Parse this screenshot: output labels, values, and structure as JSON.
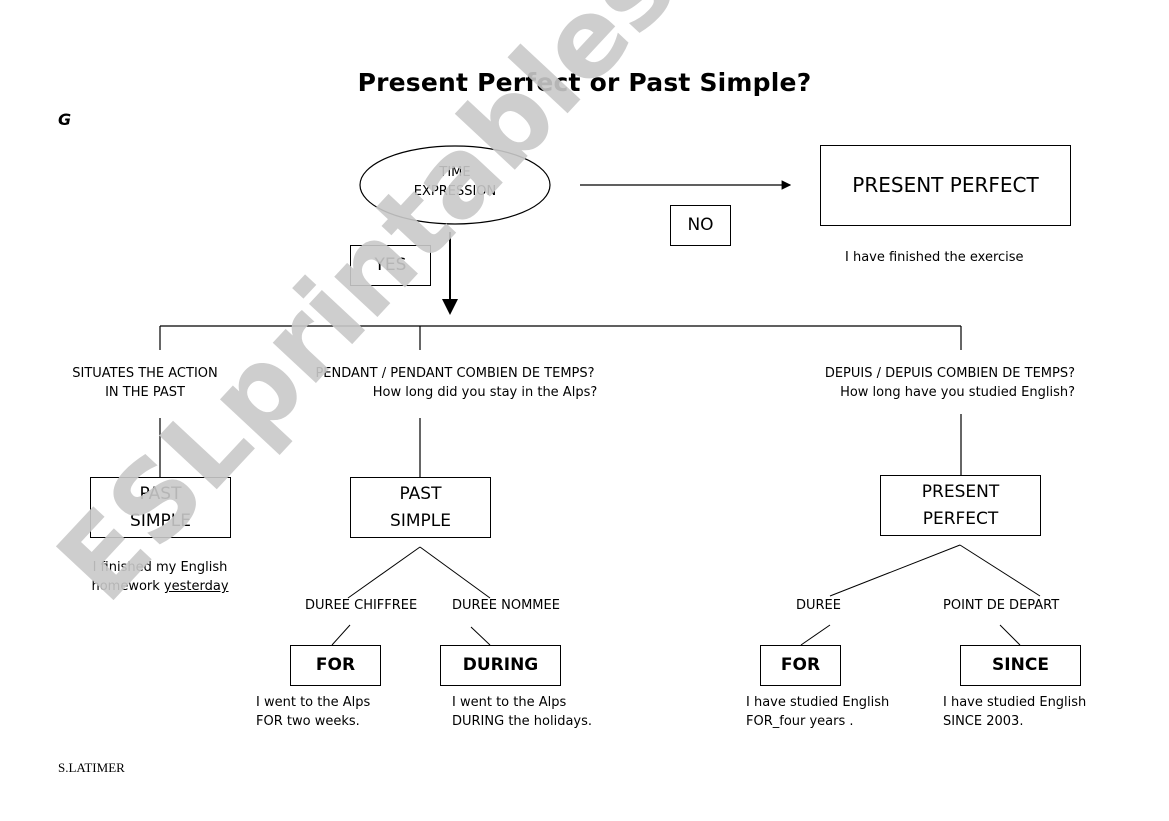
{
  "title": "Present Perfect or Past Simple?",
  "corner_mark": "G",
  "start_node": {
    "line1": "TIME",
    "line2": "EXPRESSION"
  },
  "no_branch": {
    "label": "NO",
    "result": "PRESENT PERFECT",
    "example": "I have finished the exercise"
  },
  "yes_branch": {
    "label": "YES",
    "branches": [
      {
        "question_line1": "SITUATES THE ACTION",
        "question_line2": "IN THE PAST",
        "result_line1": "PAST",
        "result_line2": "SIMPLE",
        "example_line1": "I finished my English",
        "example_line2_prefix": "homework ",
        "example_line2_underlined": "yesterday"
      },
      {
        "question_line1": "PENDANT / PENDANT COMBIEN DE TEMPS?",
        "question_line2": "How long did you stay in the Alps?",
        "result_line1": "PAST",
        "result_line2": "SIMPLE",
        "sub": [
          {
            "label": "DUREE CHIFFREE",
            "word": "FOR",
            "example_line1": "I went to the Alps",
            "example_line2": "FOR two weeks."
          },
          {
            "label": "DUREE NOMMEE",
            "word": "DURING",
            "example_line1": "I went to the Alps",
            "example_line2": "DURING the holidays."
          }
        ]
      },
      {
        "question_line1": "DEPUIS / DEPUIS COMBIEN DE TEMPS?",
        "question_line2": "How long have you studied English?",
        "result_line1": "PRESENT",
        "result_line2": "PERFECT",
        "sub": [
          {
            "label": "DUREE",
            "word": "FOR",
            "example_line1": "I have studied English",
            "example_line2": "FOR_four years ."
          },
          {
            "label": "POINT DE DEPART",
            "word": "SINCE",
            "example_line1": "I have studied English",
            "example_line2": "SINCE 2003."
          }
        ]
      }
    ]
  },
  "author": "S.LATIMER",
  "watermark": "ESLprintables.com"
}
